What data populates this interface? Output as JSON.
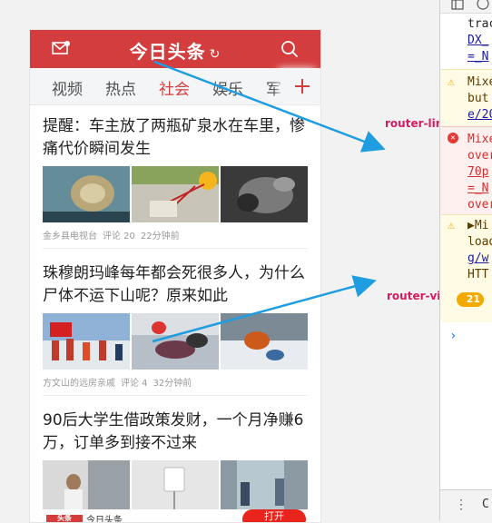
{
  "app": {
    "title": "今日头条",
    "refresh_glyph": "↻"
  },
  "tabs": [
    {
      "label": "视频",
      "active": false
    },
    {
      "label": "热点",
      "active": false
    },
    {
      "label": "社会",
      "active": true
    },
    {
      "label": "娱乐",
      "active": false
    },
    {
      "label": "军",
      "active": false
    }
  ],
  "articles": [
    {
      "title": "提醒：车主放了两瓶矿泉水在车里，惨痛代价瞬间发生",
      "source": "金乡县电视台",
      "comments": "评论 20",
      "time": "22分钟前"
    },
    {
      "title": "珠穆朗玛峰每年都会死很多人，为什么尸体不运下山呢？原来如此",
      "source": "方文山的远房亲戚",
      "comments": "评论 4",
      "time": "32分钟前"
    },
    {
      "title": "90后大学生借政策发财，一个月净赚6万，订单多到接不过来",
      "source": "",
      "comments": "",
      "time": ""
    }
  ],
  "bottom_bar": {
    "logo": "头条",
    "text": "今日头条",
    "button": "打开"
  },
  "annotations": {
    "router_link": "router-link",
    "router_view": "router-view"
  },
  "devtools": {
    "lines": [
      {
        "text": "trac",
        "style": "normal"
      },
      {
        "text": "DX_",
        "style": "link"
      },
      {
        "text": "=_N",
        "style": "link"
      },
      {
        "text": "Mixe",
        "style": "warn"
      },
      {
        "text": "but",
        "style": "warn"
      },
      {
        "text": "e/20",
        "style": "warn-link"
      },
      {
        "text": "Mixe",
        "style": "error"
      },
      {
        "text": "over",
        "style": "error"
      },
      {
        "text": "70p",
        "style": "error-link"
      },
      {
        "text": "=_N",
        "style": "error-link"
      },
      {
        "text": "over",
        "style": "error"
      },
      {
        "text": "▶Mi",
        "style": "warn"
      },
      {
        "text": "load",
        "style": "warn"
      },
      {
        "text": "g/w",
        "style": "warn-link"
      },
      {
        "text": "HTT",
        "style": "warn"
      }
    ],
    "badge_count": "21",
    "prompt": "›",
    "bottom_label": "C"
  },
  "colors": {
    "brand_red": "#d43d3d",
    "tab_active": "#d43d3d",
    "arrow": "#1e9de0",
    "route_label": "#d81b60"
  }
}
